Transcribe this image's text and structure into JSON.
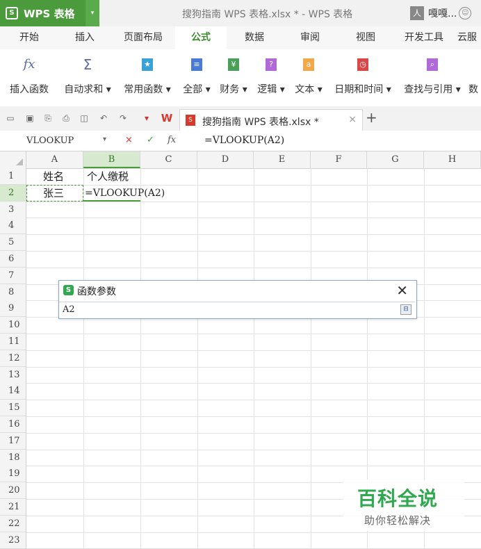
{
  "app": {
    "name": "WPS 表格",
    "logo": "S",
    "drop": "▾"
  },
  "window": {
    "title": "搜狗指南  WPS 表格.xlsx * - WPS 表格"
  },
  "user": {
    "name": "嘎嘎...",
    "avatar": "人"
  },
  "menu": [
    {
      "label": "开始",
      "active": false
    },
    {
      "label": "插入",
      "active": false
    },
    {
      "label": "页面布局",
      "active": false
    },
    {
      "label": "公式",
      "active": true
    },
    {
      "label": "数据",
      "active": false
    },
    {
      "label": "审阅",
      "active": false
    },
    {
      "label": "视图",
      "active": false
    },
    {
      "label": "开发工具",
      "active": false
    },
    {
      "label": "云服",
      "active": false
    }
  ],
  "ribbon": [
    {
      "label": "插入函数",
      "icon": "fx-icon",
      "glyph": "fx",
      "color": "#5a6aa8"
    },
    {
      "label": "自动求和 ▾",
      "icon": "sigma-icon",
      "glyph": "Σ",
      "color": "#5a6aa8"
    },
    {
      "label": "常用函数 ▾",
      "icon": "star-book-icon",
      "glyph": "★",
      "color": "#3aa0d8"
    },
    {
      "label": "全部 ▾",
      "icon": "list-book-icon",
      "glyph": "≡",
      "color": "#4a7ad8"
    },
    {
      "label": "财务 ▾",
      "icon": "finance-book-icon",
      "glyph": "¥",
      "color": "#4aa058"
    },
    {
      "label": "逻辑 ▾",
      "icon": "logic-book-icon",
      "glyph": "?",
      "color": "#b06ad8"
    },
    {
      "label": "文本 ▾",
      "icon": "text-book-icon",
      "glyph": "a",
      "color": "#f0a848"
    },
    {
      "label": "日期和时间 ▾",
      "icon": "clock-book-icon",
      "glyph": "◷",
      "color": "#d84848"
    },
    {
      "label": "查找与引用 ▾",
      "icon": "search-book-icon",
      "glyph": "⌕",
      "color": "#b06ad8"
    },
    {
      "label": "数",
      "icon": "math-book-icon",
      "glyph": "",
      "color": "#ffffff"
    }
  ],
  "quick_access": [
    "📂",
    "💾",
    "⎙",
    "🖶",
    "🔍",
    "↶",
    "↷",
    "▾"
  ],
  "doc_tab": {
    "label": "搜狗指南  WPS 表格.xlsx *",
    "close": "×",
    "new": "+"
  },
  "formula_bar": {
    "name_box": "VLOOKUP",
    "drop": "▾",
    "cancel": "×",
    "ok": "✓",
    "fx": "fx",
    "content": "=VLOOKUP(A2)"
  },
  "columns": [
    "A",
    "B",
    "C",
    "D",
    "E",
    "F",
    "G",
    "H"
  ],
  "rows": [
    "1",
    "2",
    "3",
    "4",
    "5",
    "6",
    "7",
    "8",
    "9",
    "10",
    "11",
    "12",
    "13",
    "14",
    "15",
    "16",
    "17",
    "18",
    "19",
    "20",
    "21",
    "22",
    "23"
  ],
  "cells": {
    "A1": "姓名",
    "B1": "个人缴税",
    "A2": "张三",
    "B2": "=VLOOKUP(A2)"
  },
  "dialog": {
    "title": "函数参数",
    "logo": "S",
    "close": "✕",
    "value": "A2",
    "collapse": "⊟"
  },
  "watermark": {
    "title": "百科全说",
    "subtitle": "助你轻松解决"
  }
}
